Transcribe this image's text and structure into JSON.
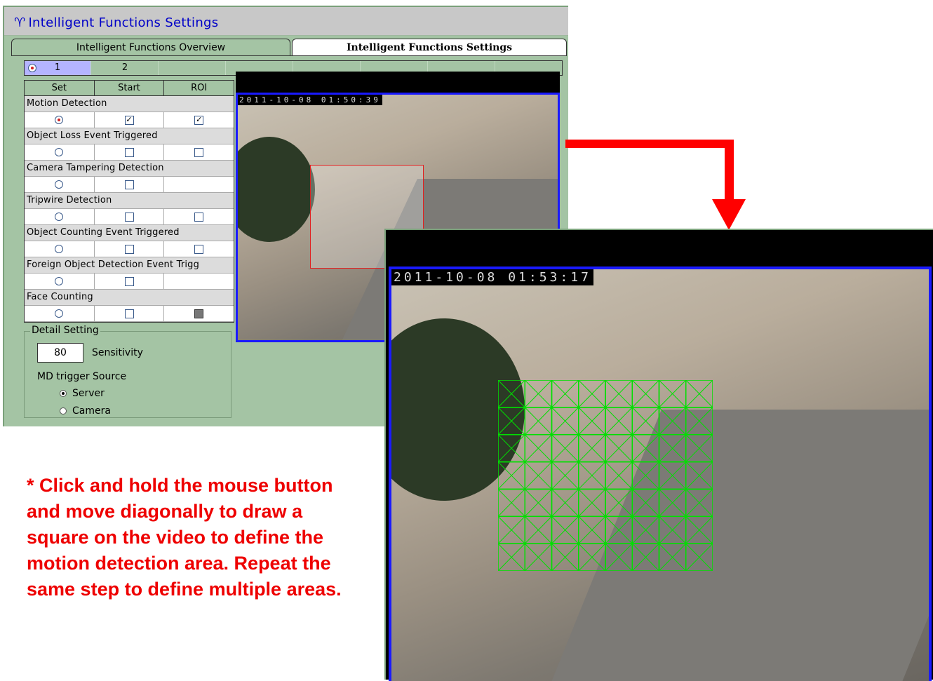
{
  "header": {
    "title": "Intelligent Functions Settings"
  },
  "tabs": [
    {
      "label": "Intelligent Functions Overview",
      "active": false
    },
    {
      "label": "Intelligent Functions Settings",
      "active": true
    }
  ],
  "channels": [
    {
      "label": "1",
      "selected": true
    },
    {
      "label": "2",
      "selected": false
    }
  ],
  "columns": [
    "Set",
    "Start",
    "ROI"
  ],
  "functions": [
    {
      "label": "Motion Detection",
      "set": true,
      "start": true,
      "roi": "checked"
    },
    {
      "label": "Object Loss Event Triggered",
      "set": false,
      "start": false,
      "roi": "unchecked"
    },
    {
      "label": "Camera Tampering Detection",
      "set": false,
      "start": false,
      "roi": "none"
    },
    {
      "label": "Tripwire Detection",
      "set": false,
      "start": false,
      "roi": "unchecked"
    },
    {
      "label": "Object Counting Event Triggered",
      "set": false,
      "start": false,
      "roi": "unchecked"
    },
    {
      "label": "Foreign Object Detection Event Trigg",
      "set": false,
      "start": false,
      "roi": "none"
    },
    {
      "label": "Face Counting",
      "set": false,
      "start": false,
      "roi": "disabled"
    }
  ],
  "detail": {
    "legend": "Detail Setting",
    "sensitivity_value": "80",
    "sensitivity_label": "Sensitivity",
    "md_trigger_label": "MD trigger Source",
    "options": [
      {
        "label": "Server",
        "selected": true
      },
      {
        "label": "Camera",
        "selected": false
      }
    ]
  },
  "video_small": {
    "timestamp": "2011-10-08 01:50:39"
  },
  "video_large": {
    "timestamp": "2011-10-08 01:53:17"
  },
  "roi_grid": {
    "cols": 8,
    "rows": 7,
    "color": "#00e000"
  },
  "note": "* Click and hold the mouse button and move diagonally to draw a square on the video to define the motion detection area. Repeat the same step to define multiple areas.",
  "colors": {
    "accent_red": "#ff0000",
    "video_border": "#1a1aff",
    "panel_bg": "#a4c4a4"
  }
}
